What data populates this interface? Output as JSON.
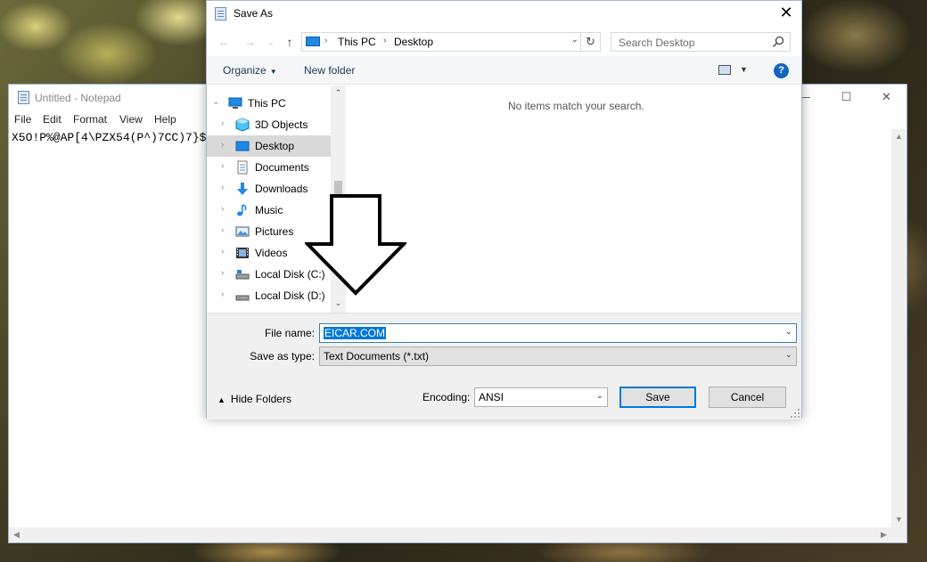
{
  "notepad": {
    "title": "Untitled - Notepad",
    "menus": [
      "File",
      "Edit",
      "Format",
      "View",
      "Help"
    ],
    "text": "X5O!P%@AP[4\\PZX54(P^)7CC)7}$"
  },
  "dialog": {
    "title": "Save As",
    "close_glyph": "✕",
    "address": {
      "segments": [
        "This PC",
        "Desktop"
      ]
    },
    "search_placeholder": "Search Desktop",
    "toolbar": {
      "organize": "Organize",
      "new_folder": "New folder",
      "help": "?"
    },
    "tree": [
      {
        "label": "This PC",
        "icon": "this-pc-icon"
      },
      {
        "label": "3D Objects",
        "icon": "3d-objects-icon"
      },
      {
        "label": "Desktop",
        "icon": "desktop-icon"
      },
      {
        "label": "Documents",
        "icon": "documents-icon"
      },
      {
        "label": "Downloads",
        "icon": "downloads-icon"
      },
      {
        "label": "Music",
        "icon": "music-icon"
      },
      {
        "label": "Pictures",
        "icon": "pictures-icon"
      },
      {
        "label": "Videos",
        "icon": "videos-icon"
      },
      {
        "label": "Local Disk (C:)",
        "icon": "drive-icon"
      },
      {
        "label": "Local Disk (D:)",
        "icon": "drive-icon"
      }
    ],
    "empty_message": "No items match your search.",
    "file_name_label": "File name:",
    "file_name_value": "EICAR.COM",
    "save_as_type_label": "Save as type:",
    "save_as_type_value": "Text Documents (*.txt)",
    "hide_folders": "Hide Folders",
    "encoding_label": "Encoding:",
    "encoding_value": "ANSI",
    "save_label": "Save",
    "cancel_label": "Cancel"
  },
  "colors": {
    "accent": "#0078d7",
    "selection_bg": "#cce8ff",
    "toolbar_text": "#1e395b"
  }
}
